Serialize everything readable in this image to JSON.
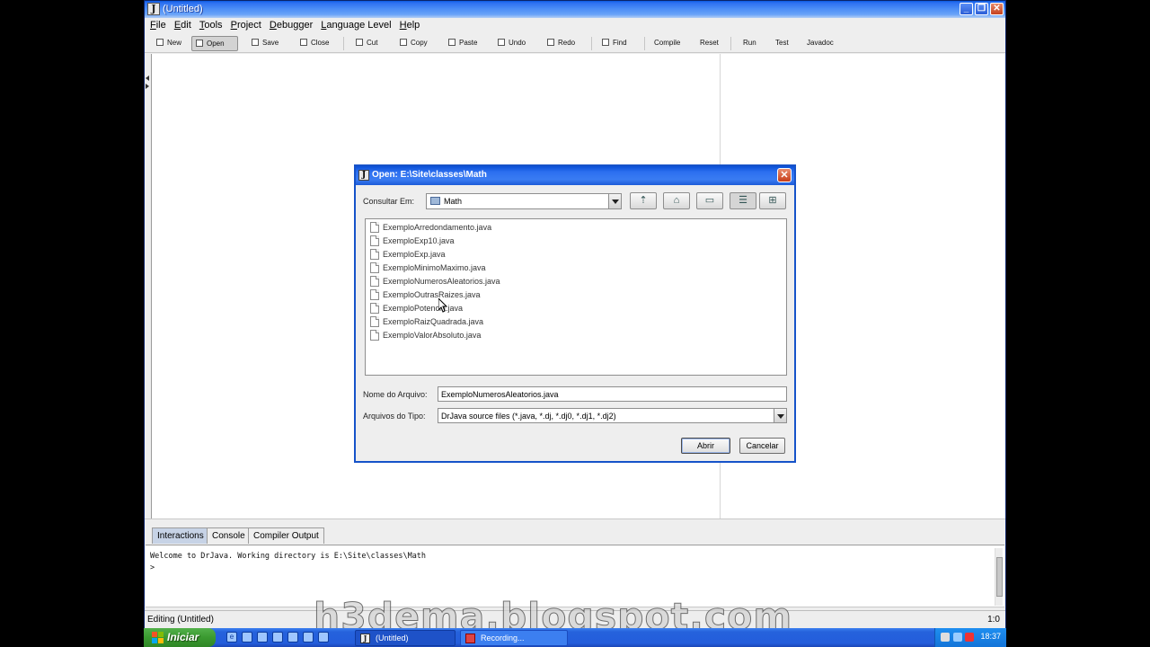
{
  "window": {
    "title": "(Untitled)",
    "app_icon": "J"
  },
  "menu": [
    "File",
    "Edit",
    "Tools",
    "Project",
    "Debugger",
    "Language Level",
    "Help"
  ],
  "toolbar": [
    {
      "label": "New",
      "icon": "new-icon"
    },
    {
      "label": "Open",
      "icon": "open-icon",
      "pressed": true
    },
    {
      "label": "Save",
      "icon": "save-icon"
    },
    {
      "label": "Close",
      "icon": "close-doc-icon"
    },
    {
      "label": "Cut",
      "icon": "cut-icon"
    },
    {
      "label": "Copy",
      "icon": "copy-icon"
    },
    {
      "label": "Paste",
      "icon": "paste-icon"
    },
    {
      "label": "Undo",
      "icon": "undo-icon"
    },
    {
      "label": "Redo",
      "icon": "redo-icon"
    },
    {
      "label": "Find",
      "icon": "find-icon"
    },
    {
      "label": "Compile"
    },
    {
      "label": "Reset"
    },
    {
      "label": "Run"
    },
    {
      "label": "Test"
    },
    {
      "label": "Javadoc"
    }
  ],
  "tabs": [
    {
      "label": "Interactions",
      "active": true
    },
    {
      "label": "Console"
    },
    {
      "label": "Compiler Output"
    }
  ],
  "interactions": {
    "welcome": "Welcome to DrJava.  Working directory is E:\\Site\\classes\\Math",
    "prompt": ">"
  },
  "status": {
    "left": "Editing (Untitled)",
    "right": "1:0"
  },
  "dialog": {
    "title": "Open:  E:\\Site\\classes\\Math",
    "lookin_label": "Consultar Em:",
    "lookin_value": "Math",
    "files": [
      "ExemploArredondamento.java",
      "ExemploExp10.java",
      "ExemploExp.java",
      "ExemploMinimoMaximo.java",
      "ExemploNumerosAleatorios.java",
      "ExemploOutrasRaizes.java",
      "ExemploPotencia.java",
      "ExemploRaizQuadrada.java",
      "ExemploValorAbsoluto.java"
    ],
    "filename_label": "Nome do Arquivo:",
    "filename_value": "ExemploNumerosAleatorios.java",
    "filetype_label": "Arquivos do Tipo:",
    "filetype_value": "DrJava source files (*.java, *.dj, *.dj0, *.dj1, *.dj2)",
    "open_button": "Abrir",
    "cancel_button": "Cancelar"
  },
  "watermark": "h3dema.blogspot.com",
  "taskbar": {
    "start": "Iniciar",
    "tasks": [
      {
        "label": "(Untitled)",
        "icon": "J",
        "active": true
      },
      {
        "label": "Recording...",
        "icon": "rec"
      }
    ],
    "clock": "18:37"
  },
  "colors": {
    "xp_blue": "#245ddb",
    "start_green": "#3a9a30",
    "dialog_border": "#1653c9"
  }
}
